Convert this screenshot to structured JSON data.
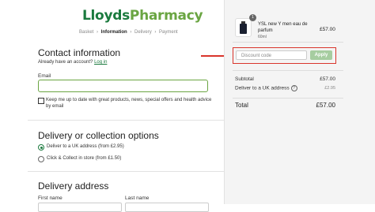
{
  "brand": {
    "part1": "Lloyds",
    "part2": "Pharmacy"
  },
  "breadcrumbs": {
    "items": [
      "Basket",
      "Information",
      "Delivery",
      "Payment"
    ],
    "separator": "›"
  },
  "contact": {
    "title": "Contact information",
    "account_prompt": "Already have an account?",
    "login_link": "Log in",
    "email_label": "Email",
    "email_value": "",
    "newsletter_text": "Keep me up to date with great products, news, special offers and health advice by email"
  },
  "delivery": {
    "title": "Delivery or collection options",
    "options": [
      {
        "label": "Deliver to a UK address (from £2.95)",
        "selected": true
      },
      {
        "label": "Click & Collect in store (from £1.50)",
        "selected": false
      }
    ]
  },
  "address": {
    "title": "Delivery address",
    "first_name_label": "First name",
    "last_name_label": "Last name"
  },
  "summary": {
    "product": {
      "name": "YSL new Y men eau de parfum",
      "size": "60ml",
      "price": "£57.00",
      "quantity": "1"
    },
    "discount": {
      "placeholder": "Discount code",
      "apply_label": "Apply"
    },
    "subtotal_label": "Subtotal",
    "subtotal_value": "£57.00",
    "shipping_label": "Deliver to a UK address",
    "shipping_value": "£2.95",
    "total_label": "Total",
    "total_value": "£57.00"
  },
  "colors": {
    "brand_green": "#1b7a3e",
    "accent_green": "#6aa542",
    "highlight_red": "#d9342b",
    "apply_button": "#a6cda0"
  },
  "icons": {
    "help": "question-circle-icon",
    "arrow": "red-arrow-annotation"
  }
}
